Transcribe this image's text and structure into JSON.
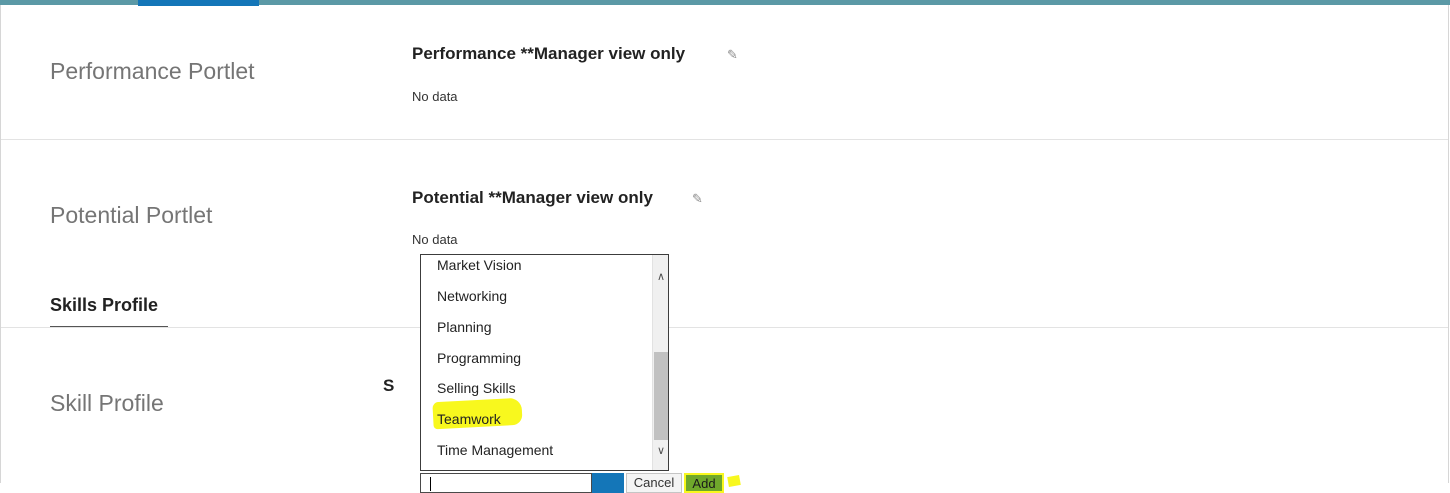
{
  "colors": {
    "top_bar": "#5b99a6",
    "active_tab": "#1476b8",
    "highlight": "#f8f81e",
    "add_button": "#6fa82b"
  },
  "performance": {
    "portlet_title": "Performance Portlet",
    "heading": "Performance **Manager view only",
    "edit_icon": "pencil-icon",
    "value": "No data"
  },
  "potential": {
    "portlet_title": "Potential Portlet",
    "heading": "Potential **Manager view only",
    "edit_icon": "pencil-icon",
    "value": "No data"
  },
  "skills_section": {
    "heading": "Skills Profile"
  },
  "skill_profile": {
    "portlet_title": "Skill Profile",
    "heading_partial": "S"
  },
  "dropdown": {
    "options": [
      "Market Vision",
      "Networking",
      "Planning",
      "Programming",
      "Selling Skills",
      "Teamwork",
      "Time Management"
    ],
    "highlighted_option": "Teamwork"
  },
  "controls": {
    "input_value": "",
    "cancel_label": "Cancel",
    "add_label": "Add"
  }
}
